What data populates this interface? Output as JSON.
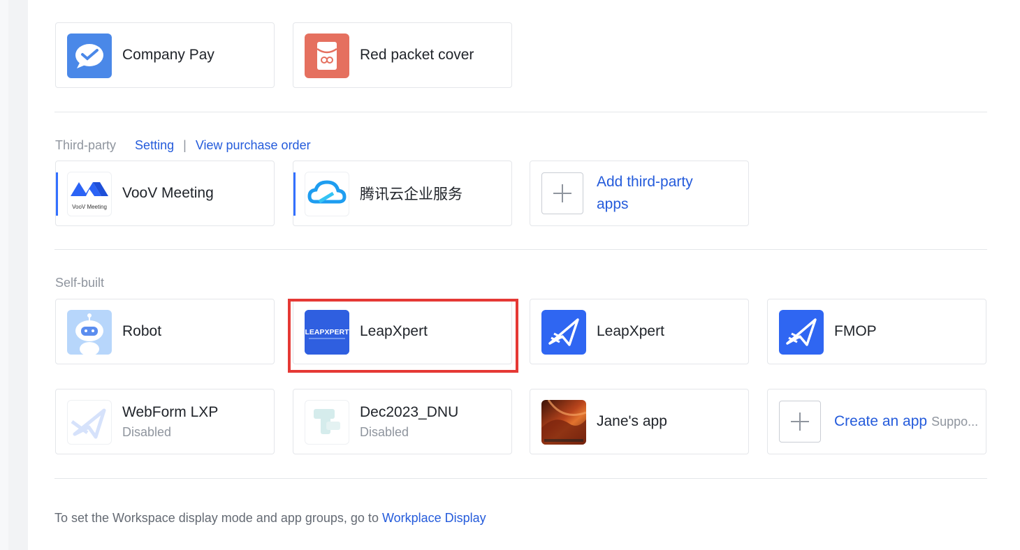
{
  "builtin_apps": [
    {
      "name": "Company Pay",
      "icon": "company-pay-icon",
      "color": "#4a88e8"
    },
    {
      "name": "Red packet cover",
      "icon": "red-packet-icon",
      "color": "#e5705f"
    }
  ],
  "third_party": {
    "label": "Third-party",
    "setting_link": "Setting",
    "separator": "|",
    "purchase_link": "View purchase order",
    "apps": [
      {
        "name": "VooV Meeting",
        "icon": "voov-meeting-icon",
        "icon_text": "VooV Meeting"
      },
      {
        "name": "腾讯云企业服务",
        "icon": "tencent-cloud-icon"
      }
    ],
    "add_label_line1": "Add third-party",
    "add_label_line2": "apps"
  },
  "self_built": {
    "label": "Self-built",
    "apps": [
      {
        "name": "Robot",
        "icon": "robot-icon"
      },
      {
        "name": "LeapXpert",
        "icon": "leapxpert-logo-icon",
        "icon_text": "LEAPXPERT",
        "highlighted": true
      },
      {
        "name": "LeapXpert",
        "icon": "leapxpert-icon"
      },
      {
        "name": "FMOP",
        "icon": "fmop-icon"
      },
      {
        "name": "WebForm LXP",
        "status": "Disabled",
        "icon": "webform-lxp-icon"
      },
      {
        "name": "Dec2023_DNU",
        "status": "Disabled",
        "icon": "dec2023-dnu-icon"
      },
      {
        "name": "Jane's app",
        "icon": "janes-app-icon"
      }
    ],
    "create_label": "Create an app",
    "create_sub": "Suppo..."
  },
  "footer": {
    "text": "To set the Workspace display mode and app groups, go to ",
    "link": "Workplace Display"
  },
  "colors": {
    "link": "#245bdb",
    "highlight": "#e53935",
    "accent": "#3370ff"
  }
}
